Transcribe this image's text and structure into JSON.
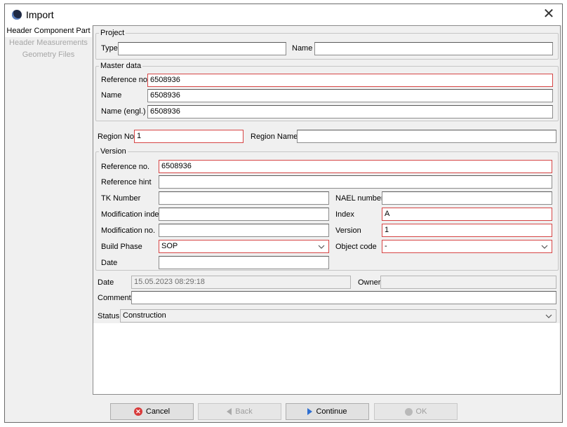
{
  "window": {
    "title": "Import",
    "close_glyph": "✕"
  },
  "nav": {
    "items": [
      {
        "label": "Header Component Part",
        "state": "active"
      },
      {
        "label": "Header Measurements",
        "state": "disabled"
      },
      {
        "label": "Geometry Files",
        "state": "disabled"
      }
    ]
  },
  "project": {
    "title": "Project",
    "type_label": "Type",
    "type_value": "",
    "name_label": "Name",
    "name_value": ""
  },
  "master": {
    "title": "Master data",
    "ref_label": "Reference no.",
    "ref_value": "6508936",
    "name_label": "Name",
    "name_value": "6508936",
    "name_engl_label": "Name (engl.)",
    "name_engl_value": "6508936"
  },
  "region": {
    "no_label": "Region No.",
    "no_value": "1",
    "name_label": "Region Name",
    "name_value": ""
  },
  "version": {
    "title": "Version",
    "ref_label": "Reference no.",
    "ref_value": "6508936",
    "ref_hint_label": "Reference hint",
    "ref_hint_value": "",
    "tk_label": "TK Number",
    "tk_value": "",
    "nael_label": "NAEL number",
    "nael_value": "",
    "mod_index_label": "Modification index",
    "mod_index_value": "",
    "index_label": "Index",
    "index_value": "A",
    "mod_no_label": "Modification no.",
    "mod_no_value": "",
    "version_label": "Version",
    "version_value": "1",
    "build_phase_label": "Build Phase",
    "build_phase_value": "SOP",
    "object_code_label": "Object code",
    "object_code_value": "-",
    "date_label": "Date",
    "date_value": ""
  },
  "meta": {
    "date_label": "Date",
    "date_value": "15.05.2023 08:29:18",
    "owner_label": "Owner",
    "owner_value": "",
    "comment_label": "Comment",
    "comment_value": "",
    "status_label": "Status",
    "status_value": "Construction"
  },
  "buttons": {
    "cancel": "Cancel",
    "back": "Back",
    "continue": "Continue",
    "ok": "OK"
  },
  "colors": {
    "required_border": "#d64545",
    "continue_arrow": "#2f6fd1",
    "cancel_icon": "#d83a3a"
  }
}
